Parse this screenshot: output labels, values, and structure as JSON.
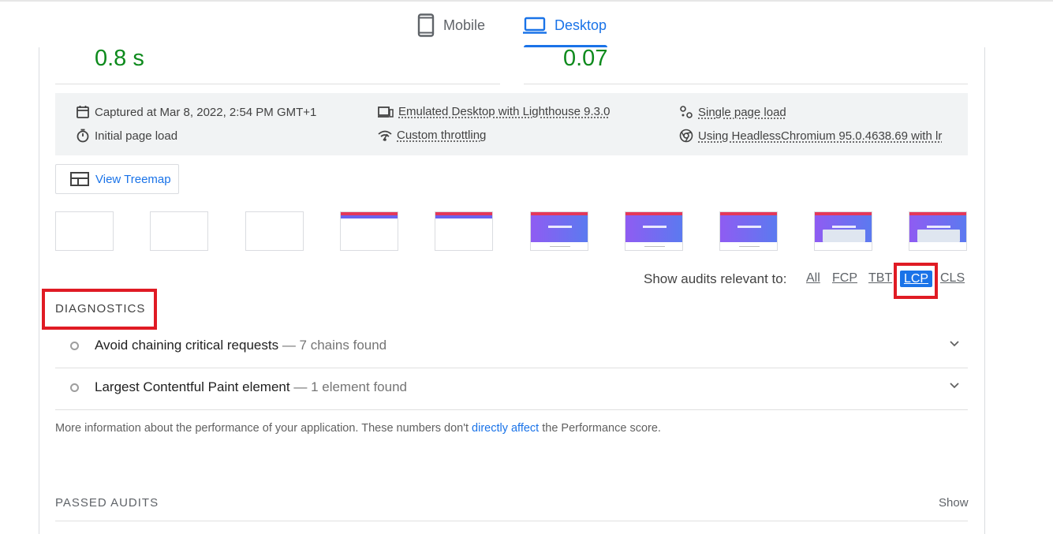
{
  "tabs": {
    "mobile_label": "Mobile",
    "desktop_label": "Desktop",
    "active": "Desktop"
  },
  "metrics": {
    "left_value": "0.8 s",
    "right_value": "0.07"
  },
  "run_info": {
    "captured": "Captured at Mar 8, 2022, 2:54 PM GMT+1",
    "initial_load": "Initial page load",
    "emulated": "Emulated Desktop with Lighthouse 9.3.0",
    "throttling": "Custom throttling",
    "single_load": "Single page load",
    "browser": "Using HeadlessChromium 95.0.4638.69 with lr"
  },
  "treemap": {
    "label": "View Treemap"
  },
  "filmstrip": {
    "frames": [
      "blank",
      "blank",
      "blank",
      "header",
      "header",
      "hero",
      "hero",
      "hero",
      "hero-mockup",
      "hero-mockup"
    ]
  },
  "filter": {
    "label": "Show audits relevant to:",
    "chips": {
      "all": "All",
      "fcp": "FCP",
      "tbt": "TBT",
      "lcp": "LCP",
      "cls": "CLS"
    },
    "active": "LCP"
  },
  "diagnostics": {
    "title": "DIAGNOSTICS",
    "audits": [
      {
        "title": "Avoid chaining critical requests",
        "display": "— 7 chains found"
      },
      {
        "title": "Largest Contentful Paint element",
        "display": "— 1 element found"
      }
    ],
    "description_pre": "More information about the performance of your application. These numbers don't ",
    "description_link": "directly affect",
    "description_post": " the Performance score."
  },
  "passed": {
    "title": "PASSED AUDITS",
    "show_label": "Show"
  },
  "colors": {
    "accent": "#1a73e8",
    "pass_green": "#0d8a1c",
    "highlight_red": "#e01b24"
  }
}
